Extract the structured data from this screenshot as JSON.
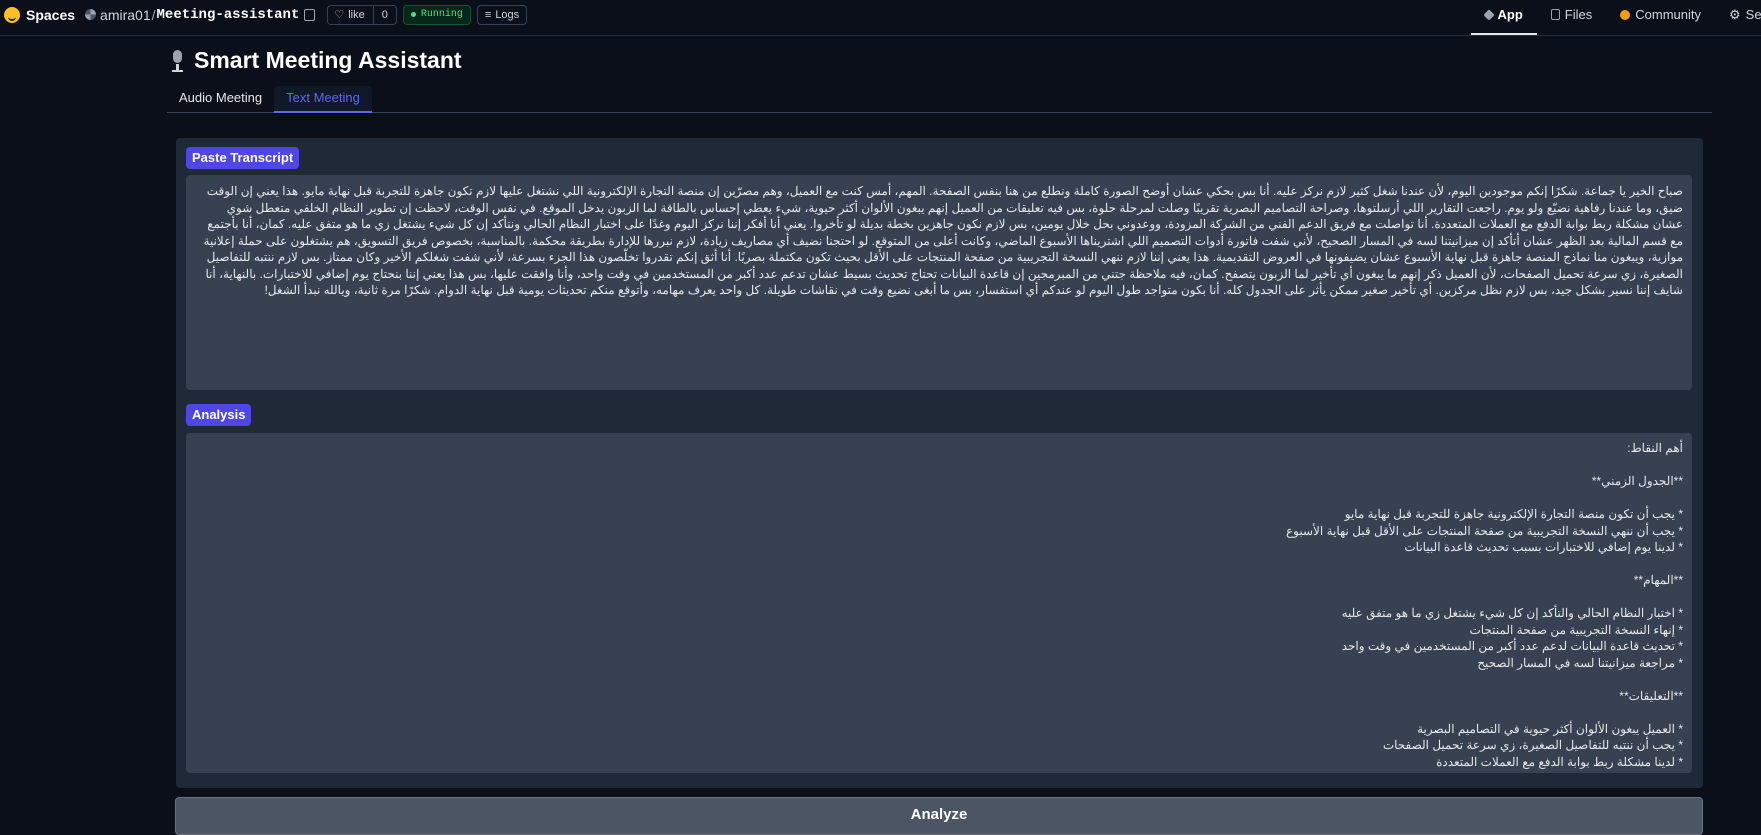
{
  "topbar": {
    "spaces_label": "Spaces",
    "owner": "amira01",
    "separator": "/",
    "repo": "Meeting-assistant",
    "like_label": "like",
    "like_count": "0",
    "status": "Running",
    "logs_label": "Logs",
    "nav": {
      "app": "App",
      "files": "Files",
      "community": "Community",
      "settings": "Settings"
    }
  },
  "header": {
    "title": "Smart Meeting Assistant"
  },
  "tabs": [
    {
      "label": "Audio Meeting",
      "active": false
    },
    {
      "label": "Text Meeting",
      "active": true
    }
  ],
  "transcript": {
    "label": "Paste Transcript",
    "value": "صباح الخير يا جماعة. شكرًا إنكم موجودين اليوم، لأن عندنا شغل كثير لازم نركز عليه. أنا بس بحكي عشان أوضح الصورة كاملة ونطلع من هنا بنفس الصفحة. المهم، أمس كنت مع العميل، وهم مصرّين إن منصة التجارة الإلكترونية اللي نشتغل عليها لازم تكون جاهزة للتجربة قبل نهاية مايو. هذا يعني إن الوقت ضيق، وما عندنا رفاهية نضيّع ولو يوم. راجعت التقارير اللي أرسلتوها، وصراحة التصاميم البصرية تقريبًا وصلت لمرحلة حلوة، بس فيه تعليقات من العميل إنهم يبغون الألوان أكثر حيوية، شيء يعطي إحساس بالطاقة لما الزبون يدخل الموقع.  في نفس الوقت، لاحظت إن تطوير النظام الخلفي متعطل شوي عشان مشكلة ربط بوابة الدفع مع العملات المتعددة. أنا تواصلت مع فريق الدعم الفني من الشركة المزودة، ووعدوني بحل خلال يومين، بس لازم نكون جاهزين بخطة بديلة لو تأخروا. يعني أنا أفكر إننا نركز اليوم وغدًا على اختبار النظام الحالي ونتأكد إن كل شيء يشتغل زي ما هو متفق عليه. كمان، أنا بأجتمع مع قسم المالية بعد الظهر عشان أتأكد إن ميزانيتنا لسه في المسار الصحيح، لأني شفت فاتورة أدوات التصميم اللي اشتريناها الأسبوع الماضي، وكانت أعلى من المتوقع. لو احتجنا نضيف أي مصاريف زيادة، لازم نبررها للإدارة بطريقة محكمة.  بالمناسبة، بخصوص فريق التسويق، هم يشتغلون على حملة إعلانية موازية، ويبغون منا نماذج المنصة جاهزة قبل نهاية الأسبوع عشان يضيفونها في العروض التقديمية. هذا يعني إننا لازم ننهي النسخة التجريبية من صفحة المنتجات على الأقل بحيث تكون مكتملة بصريًا. أنا أثق إنكم تقدروا تخلّصون هذا الجزء بسرعة، لأني شفت شغلكم الأخير وكان ممتاز. بس لازم ننتبه للتفاصيل الصغيرة، زي سرعة تحميل الصفحات، لأن العميل ذكر إنهم ما يبغون أي تأخير لما الزبون يتصفح. كمان، فيه ملاحظة جتني من المبرمجين إن قاعدة البيانات تحتاج تحديث بسيط عشان تدعم عدد أكبر من المستخدمين في وقت واحد، وأنا وافقت عليها، بس هذا يعني إننا بنحتاج يوم إضافي للاختبارات.  بالنهاية، أنا شايف إننا نسير بشكل جيد، بس لازم نظل مركزين. أي تأخير صغير ممكن يأثر على الجدول كله. أنا بكون متواجد طول اليوم لو عندكم أي استفسار، بس ما أبغى نضيع وقت في نقاشات طويلة. كل واحد يعرف مهامه، وأتوقع منكم تحديثات يومية قبل نهاية الدوام. شكرًا مرة ثانية، ويالله نبدأ الشغل!"
  },
  "analysis": {
    "label": "Analysis",
    "value": "أهم النقاط:\n\n**الجدول الزمني**\n\n* يجب أن تكون منصة التجارة الإلكترونية جاهزة للتجربة قبل نهاية مايو\n* يجب أن ننهي النسخة التجريبية من صفحة المنتجات على الأقل قبل نهاية الأسبوع\n* لدينا يوم إضافي للاختبارات بسبب تحديث قاعدة البيانات\n\n**المهام**\n\n* اختبار النظام الحالي والتأكد إن كل شيء يشتغل زي ما هو متفق عليه\n* إنهاء النسخة التجريبية من صفحة المنتجات\n* تحديث قاعدة البيانات لدعم عدد أكبر من المستخدمين في وقت واحد\n* مراجعة ميزانيتنا لسه في المسار الصحيح\n\n**التعليقات**\n\n* العميل يبغون الألوان أكثر حيوية في التصاميم البصرية\n* يجب أن ننتبه للتفاصيل الصغيرة، زي سرعة تحميل الصفحات\n* لدينا مشكلة ربط بوابة الدفع مع العملات المتعددة"
  },
  "actions": {
    "analyze_label": "Analyze"
  },
  "colors": {
    "accent": "#6366f1",
    "badge": "#4f46e5",
    "running": "#4ade80"
  }
}
